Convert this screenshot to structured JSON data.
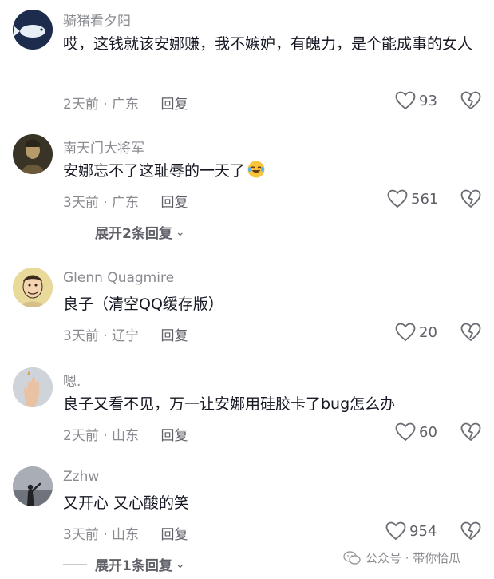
{
  "comments": [
    {
      "username": "骑猪看夕阳",
      "text": "哎，这钱就该安娜赚，我不嫉妒，有魄力，是个能成事的女人",
      "time": "2天前",
      "location": "广东",
      "reply": "回复",
      "likes": "93",
      "avatar": "white-fish-avatar"
    },
    {
      "username": "南天门大将军",
      "text": "安娜忘不了这耻辱的一天了",
      "emoji": "laughing-tears-emoji",
      "time": "3天前",
      "location": "广东",
      "reply": "回复",
      "likes": "561",
      "avatar": "warrior-avatar",
      "expand": "展开2条回复"
    },
    {
      "username": "Glenn Quagmire",
      "text": "良子（清空QQ缓存版）",
      "time": "3天前",
      "location": "辽宁",
      "reply": "回复",
      "likes": "20",
      "avatar": "cartoon-face-avatar"
    },
    {
      "username": "嗯.",
      "text": "良子又看不见，万一让安娜用硅胶卡了bug怎么办",
      "time": "2天前",
      "location": "山东",
      "reply": "回复",
      "likes": "60",
      "avatar": "hand-avatar"
    },
    {
      "username": "Zzhw",
      "text": "又开心 又心酸的笑",
      "time": "3天前",
      "location": "山东",
      "reply": "回复",
      "likes": "954",
      "avatar": "silhouette-avatar",
      "expand": "展开1条回复"
    }
  ],
  "meta_separator": "·",
  "watermark": "公众号 · 带你恰瓜"
}
